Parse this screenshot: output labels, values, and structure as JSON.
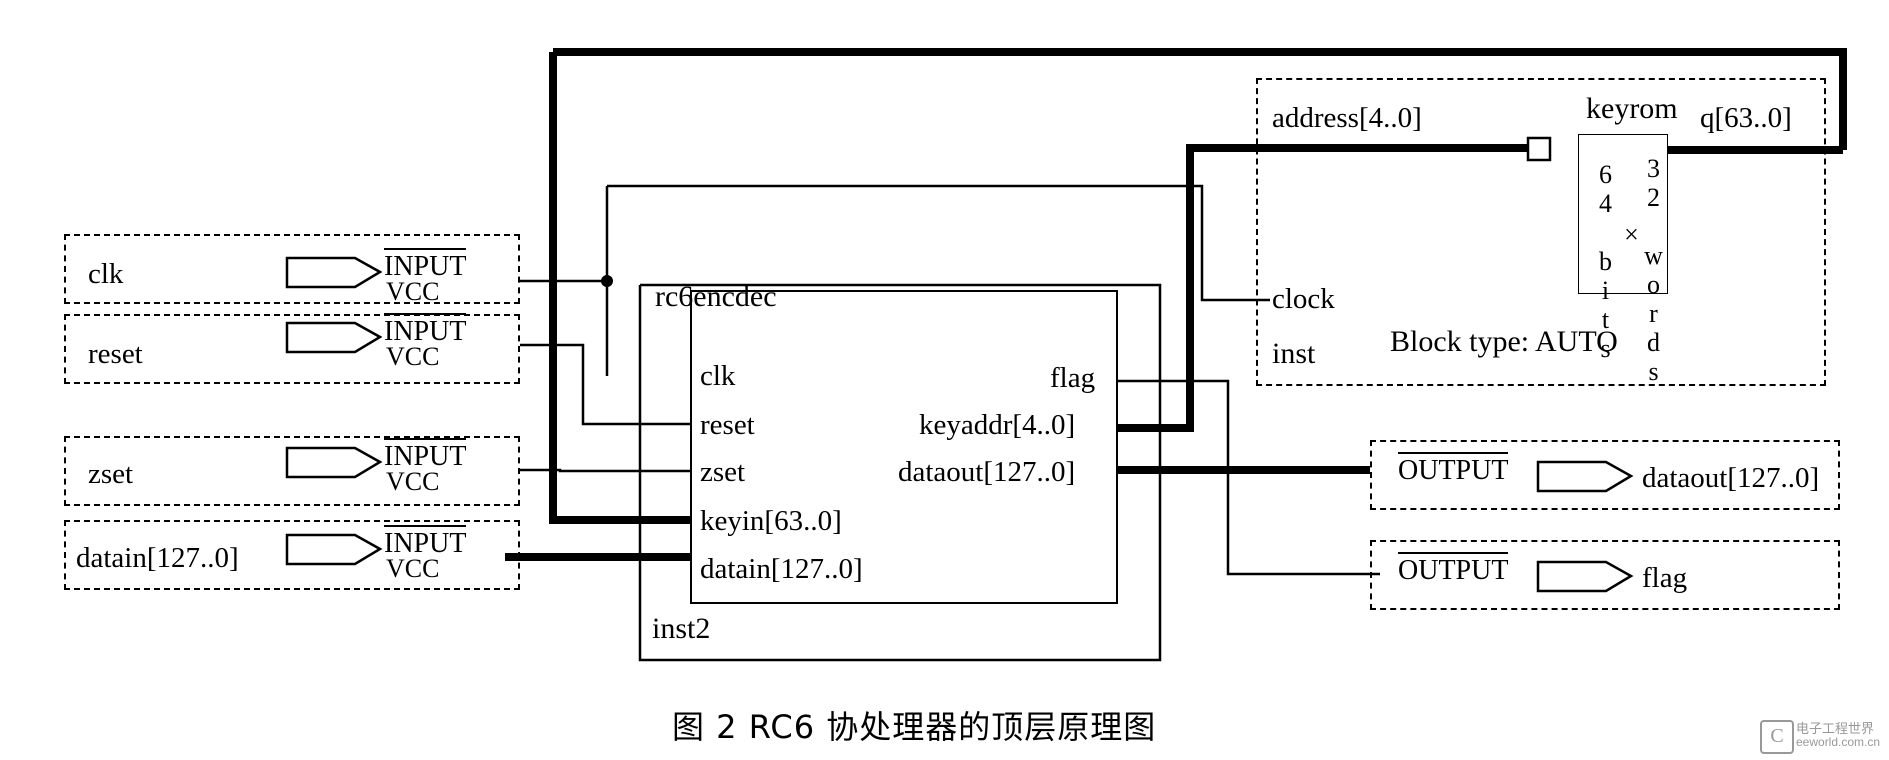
{
  "figure": {
    "caption": "图 2   RC6 协处理器的顶层原理图",
    "caption_number": "图 2",
    "caption_text": "RC6 协处理器的顶层原理图"
  },
  "inputs": [
    {
      "name": "clk",
      "pin_type": "INPUT",
      "pin_sub": "VCC"
    },
    {
      "name": "reset",
      "pin_type": "INPUT",
      "pin_sub": "VCC"
    },
    {
      "name": "zset",
      "pin_type": "INPUT",
      "pin_sub": "VCC"
    },
    {
      "name": "datain[127..0]",
      "pin_type": "INPUT",
      "pin_sub": "VCC"
    }
  ],
  "outputs": [
    {
      "name": "dataout[127..0]",
      "pin_type": "OUTPUT"
    },
    {
      "name": "flag",
      "pin_type": "OUTPUT"
    }
  ],
  "blocks": [
    {
      "id": "rc6encdec",
      "title": "rc6encdec",
      "instance": "inst2",
      "inputs": [
        "clk",
        "reset",
        "zset",
        "keyin[63..0]",
        "datain[127..0]"
      ],
      "outputs": [
        "flag",
        "keyaddr[4..0]",
        "dataout[127..0]"
      ]
    },
    {
      "id": "keyrom",
      "title": "keyrom",
      "instance": "inst",
      "inputs": [
        "address[4..0]",
        "clock"
      ],
      "outputs": [
        "q[63..0]"
      ],
      "memory_size_line1": "64 bits",
      "memory_size_line2": "×",
      "memory_size_line3": "32 words",
      "block_type": "Block type: AUTO"
    }
  ],
  "watermark": {
    "brand": "C",
    "line1": "电子工程世界",
    "line2": "eeworld.com.cn"
  }
}
